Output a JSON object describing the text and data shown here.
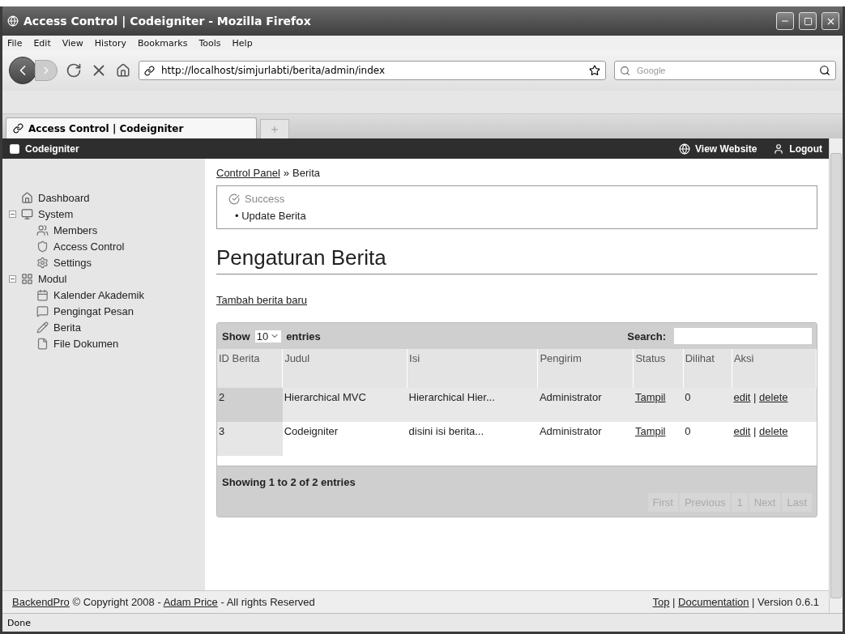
{
  "window": {
    "title": "Access Control | Codeigniter - Mozilla Firefox"
  },
  "menu": [
    "File",
    "Edit",
    "View",
    "History",
    "Bookmarks",
    "Tools",
    "Help"
  ],
  "address_bar": {
    "value": "http://localhost/simjurlabti/berita/admin/index"
  },
  "search_bar": {
    "placeholder": "Google"
  },
  "tabs": [
    {
      "label": "Access Control | Codeigniter",
      "selected": true
    }
  ],
  "header": {
    "brand": "Codeigniter",
    "links": [
      "View Website",
      "Logout"
    ]
  },
  "sidebar": {
    "items": [
      {
        "label": "Dashboard"
      },
      {
        "label": "System",
        "expanded": true,
        "children": [
          {
            "label": "Members"
          },
          {
            "label": "Access Control"
          },
          {
            "label": "Settings"
          }
        ]
      },
      {
        "label": "Modul",
        "expanded": true,
        "children": [
          {
            "label": "Kalender Akademik"
          },
          {
            "label": "Pengingat Pesan"
          },
          {
            "label": "Berita"
          },
          {
            "label": "File Dokumen"
          }
        ]
      }
    ]
  },
  "breadcrumb": {
    "link": "Control Panel",
    "separator": "»",
    "current": "Berita"
  },
  "message": {
    "title": "Success",
    "bullet": "•",
    "items": [
      "Update Berita"
    ]
  },
  "heading": "Pengaturan Berita",
  "add_link": "Tambah berita baru",
  "table": {
    "show_label": "Show",
    "page_size": "10",
    "entries_label": "entries",
    "search_label": "Search:",
    "columns": [
      "ID Berita",
      "Judul",
      "Isi",
      "Pengirim",
      "Status",
      "Dilihat",
      "Aksi"
    ],
    "action_separator": "|",
    "rows": [
      {
        "id": "2",
        "judul": "Hierarchical MVC",
        "isi": "Hierarchical Hier...",
        "pengirim": "Administrator",
        "status": "Tampil",
        "dilihat": "0",
        "edit": "edit",
        "delete": "delete"
      },
      {
        "id": "3",
        "judul": "Codeigniter",
        "isi": "disini isi berita...",
        "pengirim": "Administrator",
        "status": "Tampil",
        "dilihat": "0",
        "edit": "edit",
        "delete": "delete"
      }
    ],
    "info": "Showing 1 to 2 of 2 entries",
    "pagination": [
      {
        "label": "First",
        "disabled": true
      },
      {
        "label": "Previous",
        "disabled": true
      },
      {
        "label": "1",
        "disabled": true
      },
      {
        "label": "Next",
        "disabled": true
      },
      {
        "label": "Last",
        "disabled": true
      }
    ]
  },
  "footer": {
    "left": [
      {
        "kind": "link",
        "text": "BackendPro"
      },
      {
        "kind": "text",
        "text": " © Copyright 2008 - "
      },
      {
        "kind": "link",
        "text": "Adam Price"
      },
      {
        "kind": "text",
        "text": " - All rights Reserved"
      }
    ],
    "right": [
      {
        "kind": "link",
        "text": "Top"
      },
      {
        "kind": "text",
        "text": " | "
      },
      {
        "kind": "link",
        "text": "Documentation"
      },
      {
        "kind": "text",
        "text": " | Version 0.6.1"
      }
    ]
  },
  "status_bar": "Done"
}
